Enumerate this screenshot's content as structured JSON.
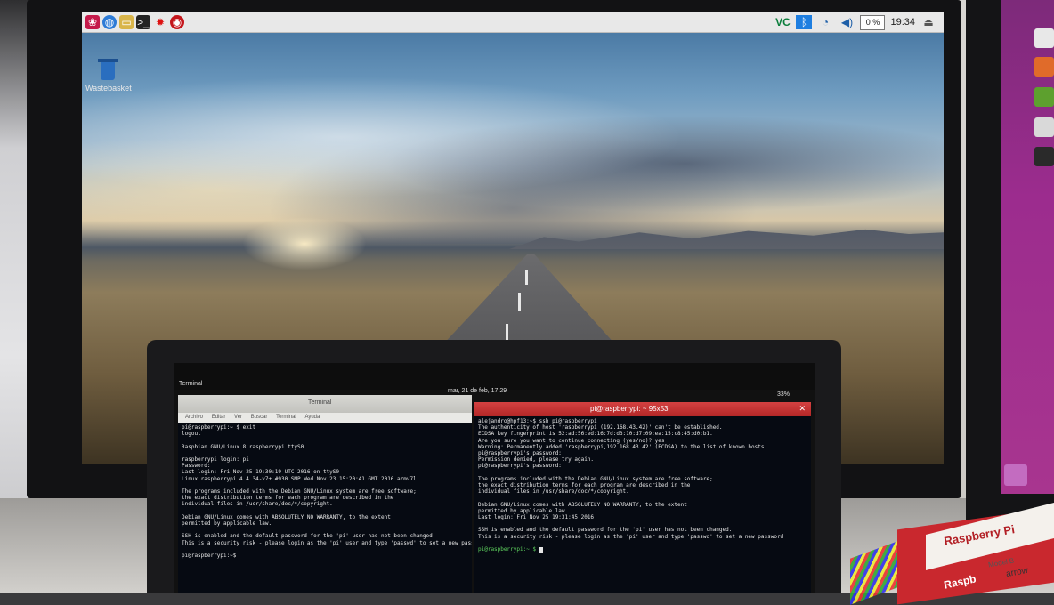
{
  "rpi_desktop": {
    "panel": {
      "launcher_icons": [
        "raspberry-menu-icon",
        "web-browser-icon",
        "file-manager-icon",
        "terminal-icon",
        "mathematica-icon",
        "wolfram-icon"
      ],
      "tray": {
        "vnc_label": "VC",
        "bluetooth_icon": "bluetooth-icon",
        "wifi_icon": "wifi-icon",
        "volume_icon": "volume-icon",
        "cpu_usage": "0 %",
        "clock": "19:34",
        "eject_icon": "eject-icon"
      }
    },
    "desktop_icons": [
      {
        "label": "Wastebasket",
        "icon": "trash-icon"
      }
    ]
  },
  "laptop": {
    "top_bar": {
      "app_menu": "Terminal",
      "clock": "mar, 21 de feb, 17:29",
      "battery": "33%"
    },
    "terminal_left": {
      "title": "Terminal",
      "menu": [
        "Archivo",
        "Editar",
        "Ver",
        "Buscar",
        "Terminal",
        "Ayuda"
      ],
      "lines": [
        "pi@raspberrypi:~ $ exit",
        "logout",
        "",
        "Raspbian GNU/Linux 8 raspberrypi ttyS0",
        "",
        "raspberrypi login: pi",
        "Password:",
        "Last login: Fri Nov 25 19:30:19 UTC 2016 on ttyS0",
        "Linux raspberrypi 4.4.34-v7+ #930 SMP Wed Nov 23 15:20:41 GMT 2016 armv7l",
        "",
        "The programs included with the Debian GNU/Linux system are free software;",
        "the exact distribution terms for each program are described in the",
        "individual files in /usr/share/doc/*/copyright.",
        "",
        "Debian GNU/Linux comes with ABSOLUTELY NO WARRANTY, to the extent",
        "permitted by applicable law.",
        "",
        "SSH is enabled and the default password for the 'pi' user has not been changed.",
        "This is a security risk - please login as the 'pi' user and type 'passwd' to set a new password",
        "",
        "pi@raspberrypi:~$ "
      ]
    },
    "terminal_right": {
      "title": "pi@raspberrypi: ~ 95x53",
      "lines": [
        "alejandro@hpf13:~$ ssh pi@raspberrypi",
        "The authenticity of host 'raspberrypi (192.168.43.42)' can't be established.",
        "ECDSA key fingerprint is 52:ad:56:ed:16:7d:d3:10:d7:09:ea:15:c8:45:d0:b1.",
        "Are you sure you want to continue connecting (yes/no)? yes",
        "Warning: Permanently added 'raspberrypi,192.168.43.42' (ECDSA) to the list of known hosts.",
        "pi@raspberrypi's password:",
        "Permission denied, please try again.",
        "pi@raspberrypi's password:",
        "",
        "The programs included with the Debian GNU/Linux system are free software;",
        "the exact distribution terms for each program are described in the",
        "individual files in /usr/share/doc/*/copyright.",
        "",
        "Debian GNU/Linux comes with ABSOLUTELY NO WARRANTY, to the extent",
        "permitted by applicable law.",
        "Last login: Fri Nov 25 19:31:45 2016",
        "",
        "SSH is enabled and the default password for the 'pi' user has not been changed.",
        "This is a security risk - please login as the 'pi' user and type 'passwd' to set a new password",
        ""
      ],
      "prompt": "pi@raspberrypi:~ $ "
    }
  },
  "box": {
    "brand": "Raspberry Pi",
    "model": "Model B",
    "logo": "arrow",
    "bottom_text": "Raspb"
  }
}
